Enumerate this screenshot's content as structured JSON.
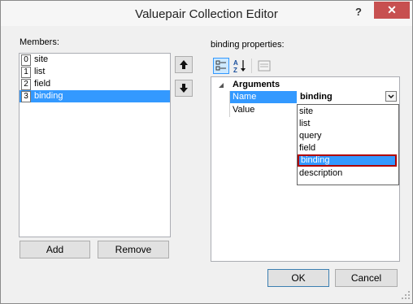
{
  "window": {
    "title": "Valuepair Collection Editor",
    "help_label": "?",
    "close_label": "✕"
  },
  "members": {
    "label": "Members:",
    "items": [
      {
        "index": "0",
        "name": "site"
      },
      {
        "index": "1",
        "name": "list"
      },
      {
        "index": "2",
        "name": "field"
      },
      {
        "index": "3",
        "name": "binding"
      }
    ],
    "selected_index": 3,
    "add_label": "Add",
    "remove_label": "Remove"
  },
  "properties": {
    "label": "binding properties:",
    "category": "Arguments",
    "rows": [
      {
        "name": "Name",
        "value": "binding"
      },
      {
        "name": "Value",
        "value": ""
      }
    ],
    "dropdown_options": [
      "site",
      "list",
      "query",
      "field",
      "binding",
      "description"
    ],
    "dropdown_selected": "binding"
  },
  "footer": {
    "ok_label": "OK",
    "cancel_label": "Cancel"
  }
}
